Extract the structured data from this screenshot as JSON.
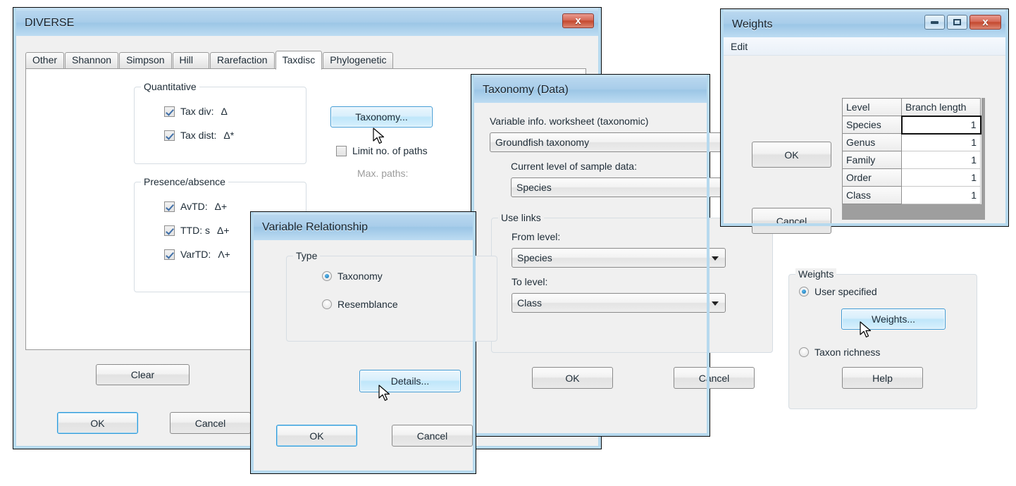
{
  "diverse": {
    "title": "DIVERSE",
    "close_label": "x",
    "tabs": [
      {
        "label": "Other",
        "active": false
      },
      {
        "label": "Shannon",
        "active": false
      },
      {
        "label": "Simpson",
        "active": false
      },
      {
        "label": "Hill",
        "active": false
      },
      {
        "label": "Rarefaction",
        "active": false
      },
      {
        "label": "Taxdisc",
        "active": true
      },
      {
        "label": "Phylogenetic",
        "active": false
      }
    ],
    "quantitative": {
      "legend": "Quantitative",
      "items": [
        {
          "label": "Tax div:",
          "symbol": "Δ",
          "checked": true
        },
        {
          "label": "Tax dist:",
          "symbol": "Δ*",
          "checked": true
        }
      ]
    },
    "presence_absence": {
      "legend": "Presence/absence",
      "items": [
        {
          "label": "AvTD:",
          "symbol": "Δ+",
          "checked": true
        },
        {
          "label": "TTD: s",
          "symbol": "Δ+",
          "checked": true
        },
        {
          "label": "VarTD:",
          "symbol": "Λ+",
          "checked": true
        }
      ]
    },
    "taxonomy_button": "Taxonomy...",
    "limit_paths": {
      "label": "Limit no. of paths",
      "checked": false
    },
    "max_paths_label": "Max. paths:",
    "clear_button": "Clear",
    "ok_button": "OK",
    "cancel_button": "Cancel"
  },
  "variable_relationship": {
    "title": "Variable Relationship",
    "type_group_legend": "Type",
    "options": [
      {
        "label": "Taxonomy",
        "selected": true
      },
      {
        "label": "Resemblance",
        "selected": false
      }
    ],
    "details_button": "Details...",
    "ok_button": "OK",
    "cancel_button": "Cancel"
  },
  "taxonomy_data": {
    "title": "Taxonomy (Data)",
    "worksheet_label": "Variable info. worksheet (taxonomic)",
    "worksheet_value": "Groundfish taxonomy",
    "current_level_label": "Current level of sample data:",
    "current_level_value": "Species",
    "use_links": {
      "legend": "Use links",
      "from_label": "From level:",
      "from_value": "Species",
      "to_label": "To level:",
      "to_value": "Class"
    },
    "weights": {
      "legend": "Weights",
      "options": [
        {
          "label": "User specified",
          "selected": true
        },
        {
          "label": "Taxon richness",
          "selected": false
        }
      ],
      "button": "Weights..."
    },
    "ok_button": "OK",
    "cancel_button": "Cancel",
    "help_button": "Help"
  },
  "weights_window": {
    "title": "Weights",
    "menu": [
      "Edit"
    ],
    "minimize_label": "minimize",
    "maximize_label": "maximize",
    "close_label": "x",
    "ok_button": "OK",
    "cancel_button": "Cancel",
    "table": {
      "headers": [
        "Level",
        "Branch length"
      ],
      "rows": [
        {
          "level": "Species",
          "branch_length": "1",
          "selected": true
        },
        {
          "level": "Genus",
          "branch_length": "1",
          "selected": false
        },
        {
          "level": "Family",
          "branch_length": "1",
          "selected": false
        },
        {
          "level": "Order",
          "branch_length": "1",
          "selected": false
        },
        {
          "level": "Class",
          "branch_length": "1",
          "selected": false
        }
      ]
    }
  },
  "colors": {
    "titlebar_blue": "#a8cdea",
    "close_red": "#c4492f",
    "accent_blue": "#2e9ada",
    "window_gray": "#f0f0f0"
  }
}
